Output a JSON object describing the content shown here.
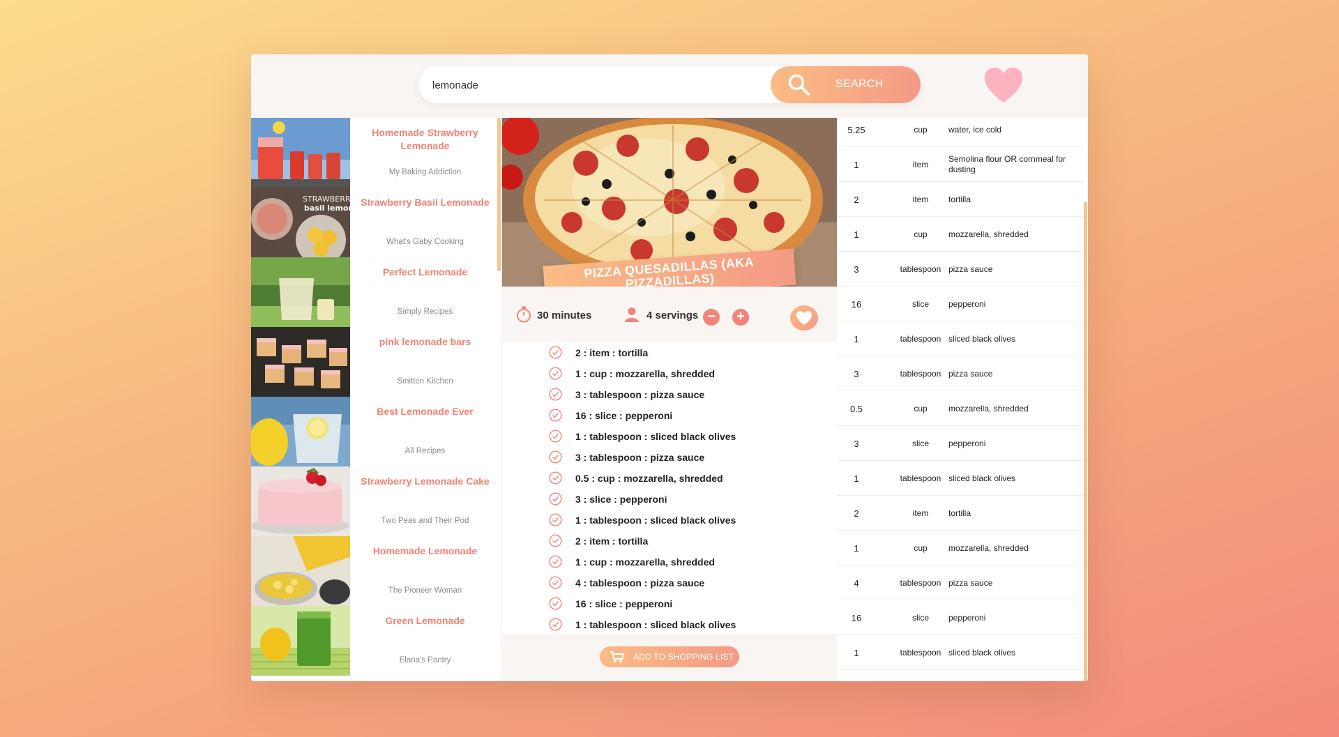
{
  "search": {
    "value": "lemonade",
    "button_label": "SEARCH"
  },
  "results": [
    {
      "title": "Homemade Strawberry Lemonade",
      "publisher": "My Baking Addiction"
    },
    {
      "title": "Strawberry Basil Lemonade",
      "publisher": "What's Gaby Cooking",
      "thumb_text": "STRAWBERRY basil lemonade"
    },
    {
      "title": "Perfect Lemonade",
      "publisher": "Simply Recipes"
    },
    {
      "title": "pink lemonade bars",
      "publisher": "Smitten Kitchen"
    },
    {
      "title": "Best Lemonade Ever",
      "publisher": "All Recipes"
    },
    {
      "title": "Strawberry Lemonade Cake",
      "publisher": "Two Peas and Their Pod"
    },
    {
      "title": "Homemade Lemonade",
      "publisher": "The Pioneer Woman"
    },
    {
      "title": "Green Lemonade",
      "publisher": "Elana's Pantry"
    }
  ],
  "recipe": {
    "title": "PIZZA QUESADILLAS (AKA PIZZADILLAS)",
    "time": "30 minutes",
    "servings": "4 servings",
    "decrease_label": "−",
    "increase_label": "+",
    "ingredients": [
      "2 : item : tortilla",
      "1 : cup : mozzarella, shredded",
      "3 : tablespoon : pizza sauce",
      "16 : slice : pepperoni",
      "1 : tablespoon : sliced black olives",
      "3 : tablespoon : pizza sauce",
      "0.5 : cup : mozzarella, shredded",
      "3 : slice : pepperoni",
      "1 : tablespoon : sliced black olives",
      "2 : item : tortilla",
      "1 : cup : mozzarella, shredded",
      "4 : tablespoon : pizza sauce",
      "16 : slice : pepperoni",
      "1 : tablespoon : sliced black olives"
    ],
    "shopping_button_label": "ADD TO SHOPPING LIST"
  },
  "shopping_list": [
    {
      "qty": "5.25",
      "unit": "cup",
      "desc": "water, ice cold"
    },
    {
      "qty": "1",
      "unit": "item",
      "desc": "Semolina flour OR cornmeal for dusting"
    },
    {
      "qty": "2",
      "unit": "item",
      "desc": "tortilla"
    },
    {
      "qty": "1",
      "unit": "cup",
      "desc": "mozzarella, shredded"
    },
    {
      "qty": "3",
      "unit": "tablespoon",
      "desc": "pizza sauce"
    },
    {
      "qty": "16",
      "unit": "slice",
      "desc": "pepperoni"
    },
    {
      "qty": "1",
      "unit": "tablespoon",
      "desc": "sliced black olives"
    },
    {
      "qty": "3",
      "unit": "tablespoon",
      "desc": "pizza sauce"
    },
    {
      "qty": "0.5",
      "unit": "cup",
      "desc": "mozzarella, shredded"
    },
    {
      "qty": "3",
      "unit": "slice",
      "desc": "pepperoni"
    },
    {
      "qty": "1",
      "unit": "tablespoon",
      "desc": "sliced black olives"
    },
    {
      "qty": "2",
      "unit": "item",
      "desc": "tortilla"
    },
    {
      "qty": "1",
      "unit": "cup",
      "desc": "mozzarella, shredded"
    },
    {
      "qty": "4",
      "unit": "tablespoon",
      "desc": "pizza sauce"
    },
    {
      "qty": "16",
      "unit": "slice",
      "desc": "pepperoni"
    },
    {
      "qty": "1",
      "unit": "tablespoon",
      "desc": "sliced black olives"
    }
  ],
  "colors": {
    "accent": "#f08272",
    "gradient_start": "#fbbc84",
    "gradient_end": "#f49a85",
    "panel": "#f9f5f3"
  },
  "icons": {
    "search": "magnifier-icon",
    "favorites": "heart-icon",
    "time": "stopwatch-icon",
    "servings": "user-icon",
    "check": "check-circle-icon",
    "cart": "cart-icon"
  }
}
